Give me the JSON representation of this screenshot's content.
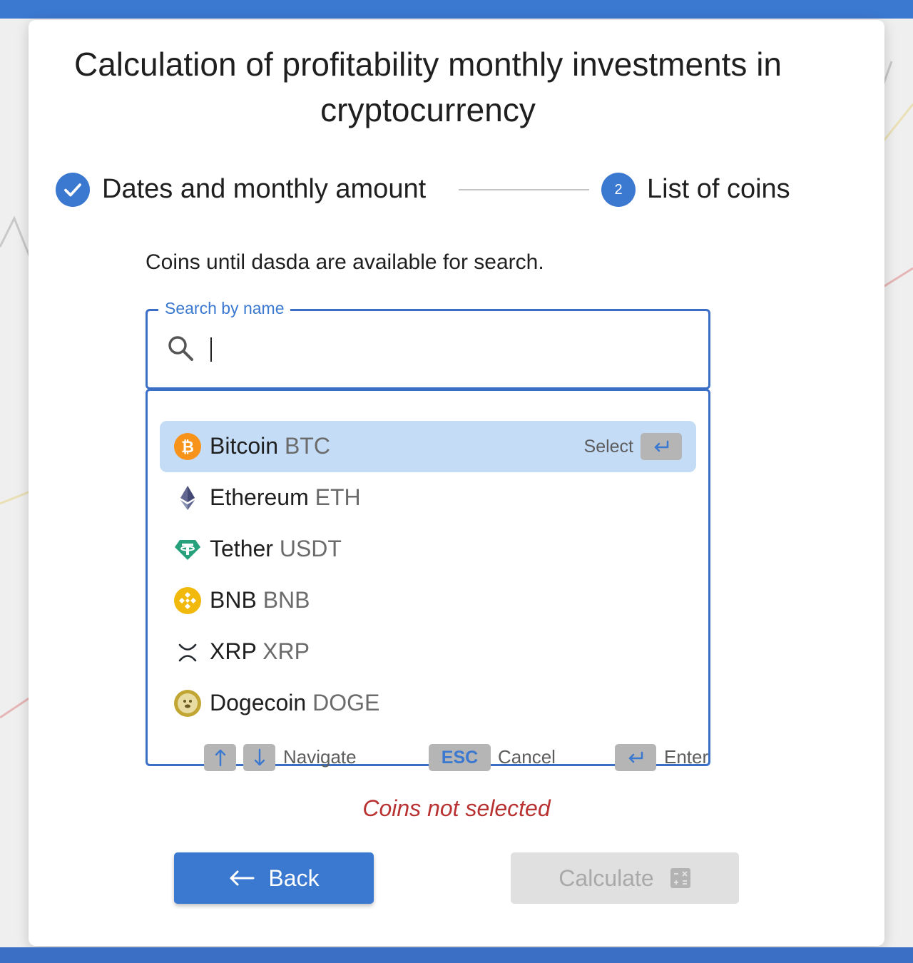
{
  "page": {
    "title": "Calculation of profitability monthly investments in cryptocurrency"
  },
  "stepper": {
    "step1_label": "Dates and monthly amount",
    "step1_status": "completed",
    "step2_number": "2",
    "step2_label": "List of coins"
  },
  "info_text": "Coins until dasda are available for search.",
  "search": {
    "label": "Search by name",
    "value": "",
    "placeholder": ""
  },
  "coins": [
    {
      "name": "Bitcoin",
      "symbol": "BTC",
      "icon": "bitcoin-icon",
      "selected": true
    },
    {
      "name": "Ethereum",
      "symbol": "ETH",
      "icon": "ethereum-icon",
      "selected": false
    },
    {
      "name": "Tether",
      "symbol": "USDT",
      "icon": "tether-icon",
      "selected": false
    },
    {
      "name": "BNB",
      "symbol": "BNB",
      "icon": "bnb-icon",
      "selected": false
    },
    {
      "name": "XRP",
      "symbol": "XRP",
      "icon": "xrp-icon",
      "selected": false
    },
    {
      "name": "Dogecoin",
      "symbol": "DOGE",
      "icon": "dogecoin-icon",
      "selected": false
    }
  ],
  "select_hint": "Select",
  "keyboard_hints": {
    "navigate_label": "Navigate",
    "esc_key": "ESC",
    "cancel_label": "Cancel",
    "enter_label": "Enter"
  },
  "error_message": "Coins not selected",
  "buttons": {
    "back_label": "Back",
    "calculate_label": "Calculate",
    "calculate_disabled": true
  },
  "colors": {
    "accent": "#3b78d0",
    "selected_row": "#c4dcf6",
    "error": "#b83232",
    "disabled_bg": "#e0e0e0"
  }
}
